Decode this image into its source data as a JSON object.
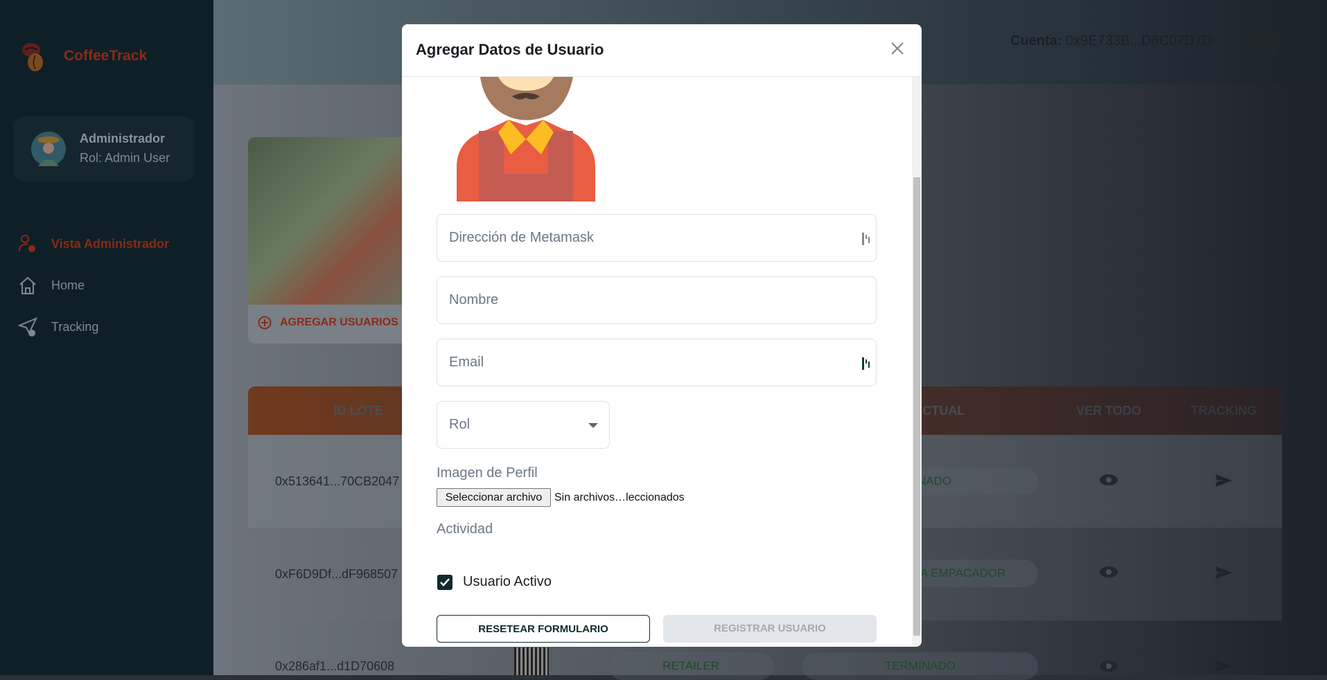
{
  "app": {
    "name": "CoffeeTrack"
  },
  "user": {
    "name": "Administrador",
    "role": "Rol: Admin User"
  },
  "nav": [
    {
      "label": "Vista Administrador",
      "icon": "user-gear-icon",
      "active": true
    },
    {
      "label": "Home",
      "icon": "home-icon"
    },
    {
      "label": "Tracking",
      "icon": "send-check-icon"
    }
  ],
  "topbar": {
    "account_label": "Cuenta:",
    "account_value": "0x9E733B...D8C07D7D"
  },
  "card": {
    "add_users_label": "AGREGAR USUARIOS"
  },
  "table": {
    "headers": [
      "ID LOTE",
      "O ACTUAL",
      "VER TODO",
      "TRACKING"
    ],
    "rows": [
      {
        "id": "0x513641...70CB2047",
        "status": "NADO"
      },
      {
        "id": "0xF6D9Df...dF968507",
        "status": "A EMPACADOR"
      },
      {
        "id": "0x286af1...d1D70608",
        "role": "RETAILER",
        "status": "TERMINADO"
      }
    ]
  },
  "modal": {
    "title": "Agregar Datos de Usuario",
    "fields": {
      "metamask_placeholder": "Dirección de Metamask",
      "name_placeholder": "Nombre",
      "email_placeholder": "Email",
      "role_placeholder": "Rol"
    },
    "image_label": "Imagen de Perfil",
    "file_button": "Seleccionar archivo",
    "file_status": "Sin archivos…leccionados",
    "activity_label": "Actividad",
    "active_checkbox": {
      "label": "Usuario Activo",
      "checked": true
    },
    "reset_button": "RESETEAR FORMULARIO",
    "submit_button": "REGISTRAR USUARIO"
  },
  "colors": {
    "brand": "#c0391b",
    "primary": "#0f3b38",
    "header_orange": "#c0622a"
  }
}
